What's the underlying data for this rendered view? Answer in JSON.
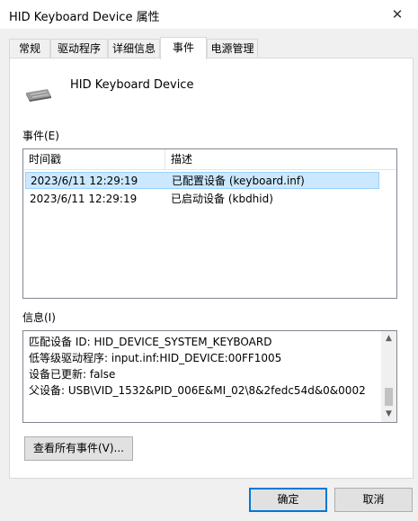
{
  "window": {
    "title": "HID Keyboard Device 属性",
    "close_icon": "close-icon"
  },
  "tabs": [
    {
      "label": "常规"
    },
    {
      "label": "驱动程序"
    },
    {
      "label": "详细信息"
    },
    {
      "label": "事件",
      "active": true
    },
    {
      "label": "电源管理"
    }
  ],
  "device": {
    "name": "HID Keyboard Device",
    "icon": "keyboard-icon"
  },
  "events": {
    "label": "事件(E)",
    "columns": [
      "时间戳",
      "描述"
    ],
    "rows": [
      {
        "timestamp": "2023/6/11 12:29:19",
        "description": "已配置设备 (keyboard.inf)",
        "selected": true
      },
      {
        "timestamp": "2023/6/11 12:29:19",
        "description": "已启动设备 (kbdhid)",
        "selected": false
      }
    ]
  },
  "info": {
    "label": "信息(I)",
    "lines": [
      "匹配设备 ID: HID_DEVICE_SYSTEM_KEYBOARD",
      "低等级驱动程序: input.inf:HID_DEVICE:00FF1005",
      "设备已更新: false",
      "父设备: USB\\VID_1532&PID_006E&MI_02\\8&2fedc54d&0&0002"
    ]
  },
  "buttons": {
    "view_all": "查看所有事件(V)...",
    "ok": "确定",
    "cancel": "取消"
  },
  "colors": {
    "accent": "#0078d7",
    "selection": "#cce8ff"
  }
}
